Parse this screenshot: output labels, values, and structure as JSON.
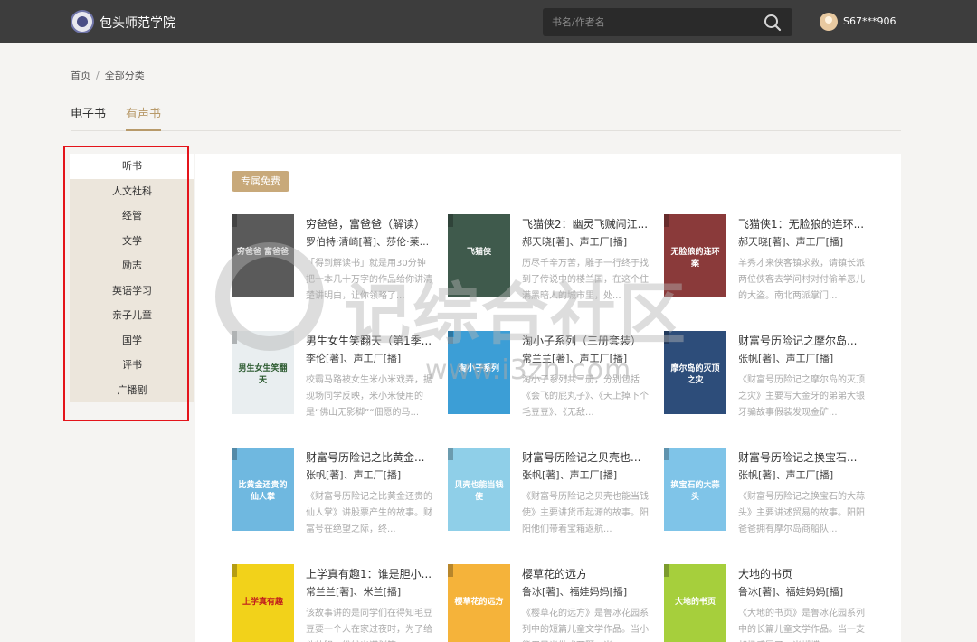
{
  "header": {
    "brand": "包头师范学院",
    "search_placeholder": "书名/作者名",
    "username": "S67***906"
  },
  "breadcrumb": {
    "home": "首页",
    "separator": "/",
    "current": "全部分类"
  },
  "tabs": [
    {
      "label": "电子书",
      "active": false
    },
    {
      "label": "有声书",
      "active": true
    }
  ],
  "sidebar": {
    "items": [
      {
        "label": "听书",
        "active": true
      },
      {
        "label": "人文社科"
      },
      {
        "label": "经管"
      },
      {
        "label": "文学"
      },
      {
        "label": "励志"
      },
      {
        "label": "英语学习"
      },
      {
        "label": "亲子儿童"
      },
      {
        "label": "国学"
      },
      {
        "label": "评书"
      },
      {
        "label": "广播剧"
      }
    ]
  },
  "badge": "专属免费",
  "books": [
    {
      "title": "穷爸爸，富爸爸（解读）",
      "author": "罗伯特·清崎[著]、莎伦·莱...",
      "desc": "「得到解读书」就是用30分钟把一本几十万字的作品给你讲清楚讲明白，让你领略了...",
      "cover_color": "#5a5a5a",
      "cover_text": "穷爸爸 富爸爸"
    },
    {
      "title": "飞猫侠2：幽灵飞贼闹江...",
      "author": "郝天晓[著]、声工厂[播]",
      "desc": "历尽千辛万苦，雕子一行终于找到了传说中的楼兰国，在这个住满黑暗人的城市里，处...",
      "cover_color": "#3f5a4c",
      "cover_text": "飞猫侠"
    },
    {
      "title": "飞猫侠1：无脸狼的连环...",
      "author": "郝天晓[著]、声工厂[播]",
      "desc": "羊秀才来侠客镇求救，请镇长派两位侠客去学问村对付偷羊恶儿的大盗。南北两派掌门...",
      "cover_color": "#8a3a3a",
      "cover_text": "无脸狼的连环案"
    },
    {
      "title": "男生女生笑翻天（第1季...",
      "author": "李伦[著]、声工厂[播]",
      "desc": "校霸马路被女生米小米戏弄，据现场同学反映，米小米使用的是“佛山无影脚”“佃愿的马...",
      "cover_color": "#e9eef0",
      "cover_text": "男生女生笑翻天"
    },
    {
      "title": "淘小子系列（三册套装）",
      "author": "常兰兰[著]、声工厂[播]",
      "desc": "淘小子系列共三册，分别包括《会飞的屁丸子》、《天上掉下个毛豆豆》、《无敌...",
      "cover_color": "#3c9ed6",
      "cover_text": "淘小子系列"
    },
    {
      "title": "财富号历险记之摩尔岛...",
      "author": "张帆[著]、声工厂[播]",
      "desc": "《财富号历险记之摩尔岛的灭顶之灾》主要写大金牙的弟弟大银牙骗故事假装发现金矿...",
      "cover_color": "#2d4d7a",
      "cover_text": "摩尔岛的灭顶之灾"
    },
    {
      "title": "财富号历险记之比黄金...",
      "author": "张帆[著]、声工厂[播]",
      "desc": "《财富号历险记之比黄金还贵的仙人掌》讲股票产生的故事。财富号在绝望之际，终...",
      "cover_color": "#6fb8e0",
      "cover_text": "比黄金还贵的仙人掌"
    },
    {
      "title": "财富号历险记之贝壳也...",
      "author": "张帆[著]、声工厂[播]",
      "desc": "《财富号历险记之贝壳也能当钱使》主要讲货币起源的故事。阳阳他们带着宝箱返航...",
      "cover_color": "#8fcfe8",
      "cover_text": "贝壳也能当钱使"
    },
    {
      "title": "财富号历险记之换宝石...",
      "author": "张帆[著]、声工厂[播]",
      "desc": "《财富号历险记之换宝石的大蒜头》主要讲述贸易的故事。阳阳爸爸拥有摩尔岛商船队...",
      "cover_color": "#7fc4e8",
      "cover_text": "换宝石的大蒜头"
    },
    {
      "title": "上学真有趣1：谁是胆小...",
      "author": "常兰兰[著]、米兰[播]",
      "desc": "该故事讲的是同学们在得知毛豆豆要一个人在家过夜时，为了给他壮胆，纷纷出谋划策...",
      "cover_color": "#f2d21a",
      "cover_text": "上学真有趣"
    },
    {
      "title": "樱草花的远方",
      "author": "鲁冰[著]、福娃妈妈[播]",
      "desc": "《樱草花的远方》是鲁冰花园系列中的短篇儿童文学作品。当小熊用目光做成两颗，当...",
      "cover_color": "#f5b33a",
      "cover_text": "樱草花的远方"
    },
    {
      "title": "大地的书页",
      "author": "鲁冰[著]、福娃妈妈[播]",
      "desc": "《大地的书页》是鲁冰花园系列中的长篇儿童文学作品。当一支胡杨感冒了，当蝴蝶...",
      "cover_color": "#a6cf3c",
      "cover_text": "大地的书页"
    }
  ],
  "watermark": {
    "text": "记综合社区",
    "url": "www.i3zh.com"
  }
}
